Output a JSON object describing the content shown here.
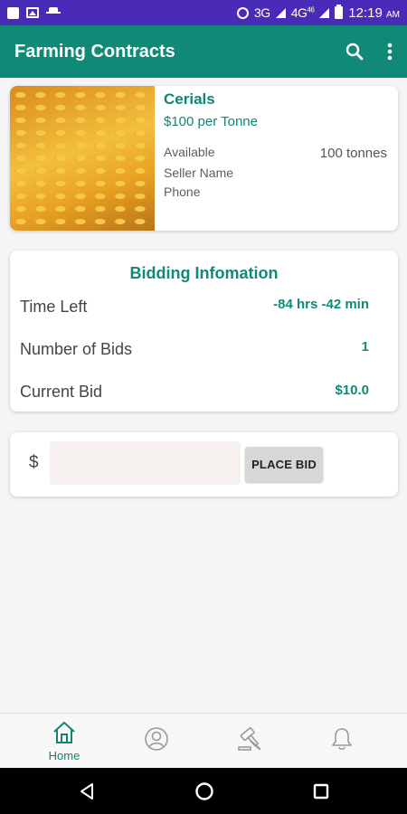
{
  "status_bar": {
    "network": "3G",
    "network2": "4G",
    "network2_sup": "46",
    "time": "12:19",
    "ampm": "AM",
    "background": "#4a2bb8"
  },
  "app_bar": {
    "title": "Farming Contracts",
    "background": "#108a77",
    "icons": [
      "search-icon",
      "more-vertical-icon"
    ]
  },
  "product": {
    "name": "Cerials",
    "price": "$100 per Tonne",
    "available_label": "Available",
    "available_value": "100 tonnes",
    "seller_label": "Seller Name",
    "phone_label": "Phone",
    "image": "corn-image"
  },
  "bidding": {
    "heading": "Bidding Infomation",
    "time_left_label": "Time Left",
    "time_left_value": "-84 hrs -42 min",
    "num_bids_label": "Number of Bids",
    "num_bids_value": "1",
    "current_bid_label": "Current Bid",
    "current_bid_value": "$10.0"
  },
  "place_bid": {
    "currency": "$",
    "input_value": "",
    "input_placeholder": "",
    "button_label": "PLACE BID"
  },
  "bottom_nav": {
    "home_label": "Home",
    "icons": [
      "home-icon",
      "profile-icon",
      "auction-gavel-icon",
      "bell-icon"
    ],
    "active_color": "#128572"
  },
  "system_nav": {
    "icons": [
      "back-icon",
      "home-circle-icon",
      "recents-icon"
    ]
  }
}
